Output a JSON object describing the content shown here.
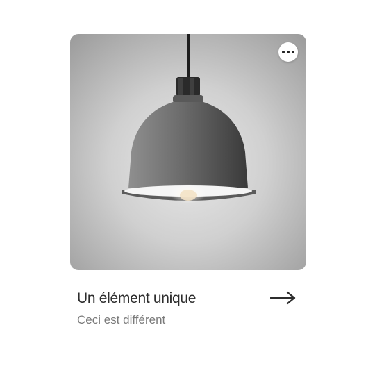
{
  "card": {
    "image_alt": "pendant-lamp-photo",
    "title": "Un élément unique",
    "subtitle": "Ceci est différent",
    "menu_icon": "more-horizontal-icon",
    "arrow_icon": "arrow-right-icon"
  },
  "colors": {
    "title": "#2d2d2d",
    "subtitle": "#7a7a7a",
    "menu_button_bg": "#ffffff"
  }
}
